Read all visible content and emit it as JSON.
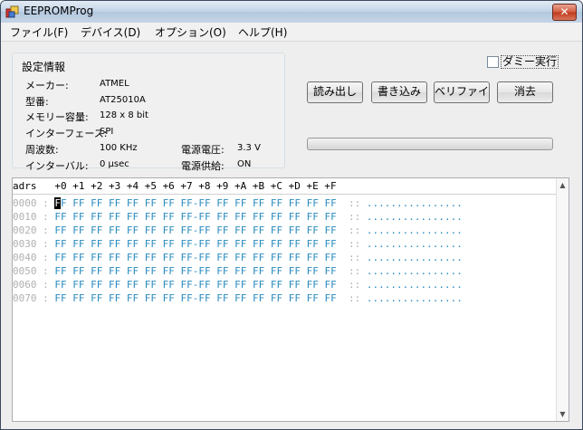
{
  "window": {
    "title": "EEPROMProg",
    "close_glyph": "✕"
  },
  "menu": [
    {
      "label": "ファイル(F)"
    },
    {
      "label": "デバイス(D)"
    },
    {
      "label": "オプション(O)"
    },
    {
      "label": "ヘルプ(H)"
    }
  ],
  "settings": {
    "title": "設定情報",
    "maker_label": "メーカー:",
    "maker_value": "ATMEL",
    "model_label": "型番:",
    "model_value": "AT25010A",
    "capacity_label": "メモリー容量:",
    "capacity_value": "128 x 8 bit",
    "interface_label": "インターフェース:",
    "interface_value": "SPI",
    "frequency_label": "周波数:",
    "frequency_value": "100 KHz",
    "voltage_label": "電源電圧:",
    "voltage_value": "3.3 V",
    "interval_label": "インターバル:",
    "interval_value": "0 µsec",
    "supply_label": "電源供給:",
    "supply_value": "ON"
  },
  "dummy_run": {
    "label": "ダミー実行",
    "checked": false
  },
  "buttons": {
    "read": "読み出し",
    "write": "書き込み",
    "verify": "ベリファイ",
    "erase": "消去"
  },
  "progress": {
    "value": 0
  },
  "dump": {
    "header": "adrs   +0 +1 +2 +3 +4 +5 +6 +7 +8 +9 +A +B +C +D +E +F",
    "rows": [
      {
        "addr": "0000",
        "ascii": "................"
      },
      {
        "addr": "0010",
        "ascii": "................"
      },
      {
        "addr": "0020",
        "ascii": "................"
      },
      {
        "addr": "0030",
        "ascii": "................"
      },
      {
        "addr": "0040",
        "ascii": "................"
      },
      {
        "addr": "0050",
        "ascii": "................"
      },
      {
        "addr": "0060",
        "ascii": "................"
      },
      {
        "addr": "0070",
        "ascii": "................"
      }
    ],
    "byte_value": "FF",
    "colon": ":",
    "double_colon": "::"
  },
  "colors": {
    "hex": "#2a8bbf",
    "address": "#b0b0b0"
  }
}
